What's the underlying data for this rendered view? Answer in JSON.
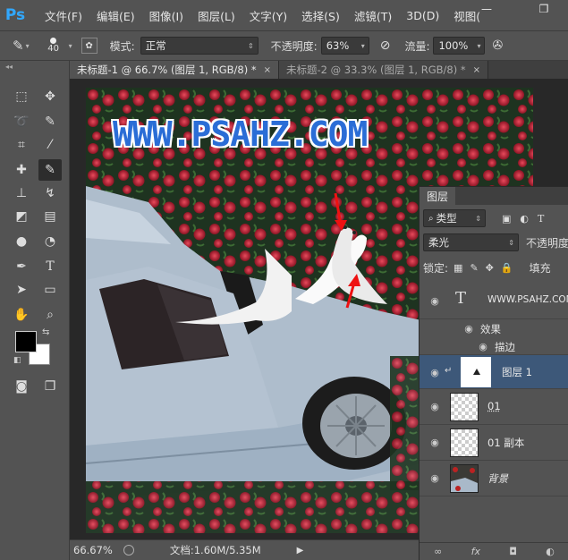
{
  "app": {
    "logo": "Ps"
  },
  "menu": [
    "文件(F)",
    "编辑(E)",
    "图像(I)",
    "图层(L)",
    "文字(Y)",
    "选择(S)",
    "滤镜(T)",
    "3D(D)",
    "视图("
  ],
  "window": {
    "minimize": "—",
    "restore": "❐"
  },
  "options": {
    "brush_size": "40",
    "mode_label": "模式:",
    "mode_value": "正常",
    "opacity_label": "不透明度:",
    "opacity_value": "63%",
    "flow_label": "流量:",
    "flow_value": "100%"
  },
  "tabs": [
    {
      "label": "未标题-1 @ 66.7% (图层 1, RGB/8) *",
      "close": "×"
    },
    {
      "label": "未标题-2 @ 33.3% (图层 1, RGB/8) *",
      "close": "×"
    }
  ],
  "canvas": {
    "watermark": "WWW.PSAHZ.COM"
  },
  "status": {
    "zoom": "66.67%",
    "doc": "文档:1.60M/5.35M"
  },
  "layers_panel": {
    "title": "图层",
    "filter": "类型",
    "blend_mode": "柔光",
    "opacity_label": "不透明度",
    "lock_label": "锁定:",
    "fill_label": "填充",
    "layers": [
      {
        "name": "WWW.PSAHZ.COM",
        "type": "text"
      },
      {
        "name": "效果",
        "type": "effects"
      },
      {
        "name": "描边",
        "type": "effect-item"
      },
      {
        "name": "图层 1",
        "type": "pixel",
        "selected": true
      },
      {
        "name": "01",
        "type": "pixel"
      },
      {
        "name": "01 副本",
        "type": "pixel"
      },
      {
        "name": "背景",
        "type": "background"
      }
    ],
    "footer": [
      "∞",
      "fx",
      "◘",
      "◐",
      "▭",
      "▢",
      "🗑"
    ]
  },
  "colors": {
    "ui_bg": "#535353",
    "canvas_bg": "#282828",
    "selected_layer": "#3d5879",
    "watermark": "#2a6dd6"
  }
}
